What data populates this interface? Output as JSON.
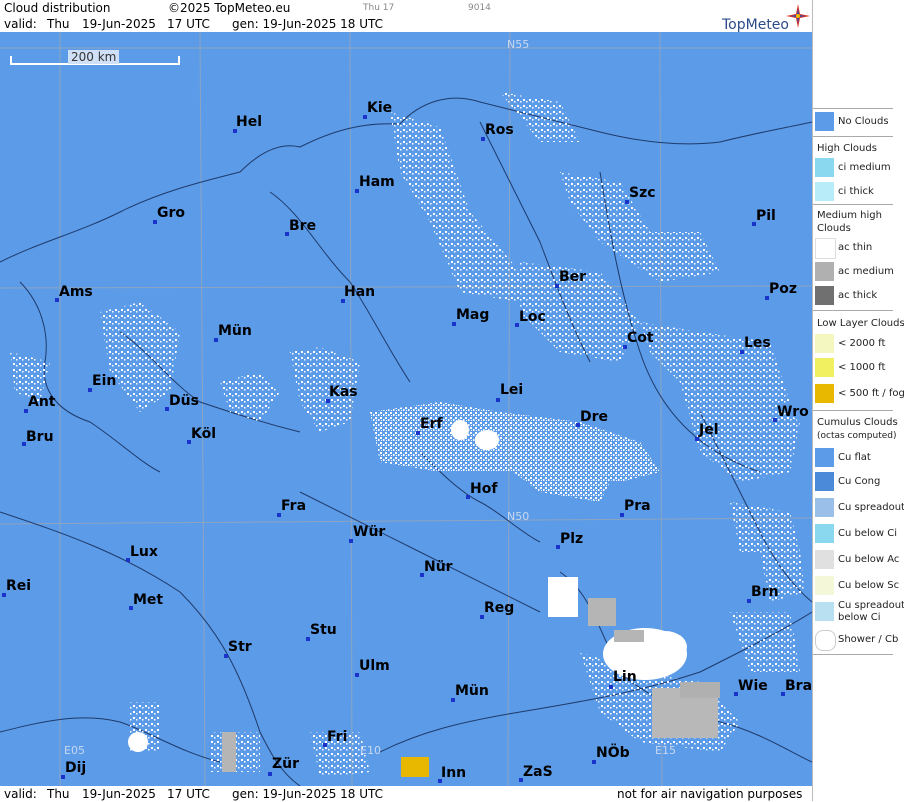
{
  "header": {
    "title": "Cloud distribution",
    "copyright": "©2025 TopMeteo.eu",
    "tiny1": "Thu 17",
    "tiny2": "9014",
    "valid_label": "valid:",
    "valid_day": "Thu",
    "valid_date": "19-Jun-2025",
    "valid_time": "17 UTC",
    "gen_label": "gen: 19-Jun-2025 18 UTC",
    "brand": "TopMeteo"
  },
  "footer": {
    "valid_label": "valid:",
    "valid_day": "Thu",
    "valid_date": "19-Jun-2025",
    "valid_time": "17 UTC",
    "gen_label": "gen: 19-Jun-2025 18 UTC",
    "disclaimer": "not for air navigation purposes"
  },
  "scale_label": "200 km",
  "grid_labels": {
    "n55": "N55",
    "n50": "N50",
    "e05": "E05",
    "e10": "E10",
    "e15": "E15"
  },
  "cities": [
    {
      "name": "Kie"
    },
    {
      "name": "Hel"
    },
    {
      "name": "Ros"
    },
    {
      "name": "Ham"
    },
    {
      "name": "Szc"
    },
    {
      "name": "Gro"
    },
    {
      "name": "Bre"
    },
    {
      "name": "Pil"
    },
    {
      "name": "Ber"
    },
    {
      "name": "Ams"
    },
    {
      "name": "Han"
    },
    {
      "name": "Poz"
    },
    {
      "name": "Mag"
    },
    {
      "name": "Loc"
    },
    {
      "name": "Mün"
    },
    {
      "name": "Cot"
    },
    {
      "name": "Les"
    },
    {
      "name": "Ein"
    },
    {
      "name": "Kas"
    },
    {
      "name": "Lei"
    },
    {
      "name": "Ant"
    },
    {
      "name": "Düs"
    },
    {
      "name": "Wro"
    },
    {
      "name": "Erf"
    },
    {
      "name": "Dre"
    },
    {
      "name": "Bru"
    },
    {
      "name": "Köl"
    },
    {
      "name": "Jel"
    },
    {
      "name": "Hof"
    },
    {
      "name": "Fra"
    },
    {
      "name": "Pra"
    },
    {
      "name": "Wür"
    },
    {
      "name": "Plz"
    },
    {
      "name": "Lux"
    },
    {
      "name": "Nür"
    },
    {
      "name": "Rei"
    },
    {
      "name": "Met"
    },
    {
      "name": "Reg"
    },
    {
      "name": "Brn"
    },
    {
      "name": "Stu"
    },
    {
      "name": "Str"
    },
    {
      "name": "Ulm"
    },
    {
      "name": "Lin"
    },
    {
      "name": "Mün"
    },
    {
      "name": "Wie"
    },
    {
      "name": "Bra"
    },
    {
      "name": "Fri"
    },
    {
      "name": "NÖb"
    },
    {
      "name": "Dij"
    },
    {
      "name": "Zür"
    },
    {
      "name": "Inn"
    },
    {
      "name": "ZaS"
    }
  ],
  "legend": {
    "no_clouds": "No Clouds",
    "high_title": "High Clouds",
    "ci_medium": "ci medium",
    "ci_thick": "ci thick",
    "medium_title_1": "Medium high",
    "medium_title_2": "Clouds",
    "ac_thin": "ac thin",
    "ac_medium": "ac medium",
    "ac_thick": "ac thick",
    "low_title": "Low Layer Clouds",
    "low_2000": "< 2000 ft",
    "low_1000": "< 1000 ft",
    "low_500": "< 500 ft / fog",
    "cu_title": "Cumulus Clouds",
    "cu_sub": "(octas computed)",
    "cu_flat": "Cu flat",
    "cu_cong": "Cu Cong",
    "cu_spreadout": "Cu spreadout",
    "cu_below_ci": "Cu below Ci",
    "cu_below_ac": "Cu below Ac",
    "cu_below_sc": "Cu below Sc",
    "cu_spread_ci_1": "Cu spreadout",
    "cu_spread_ci_2": "below Ci",
    "shower": "Shower / Cb"
  },
  "colors": {
    "sea_land": "#5b9be8",
    "city_dot": "#1a33c8",
    "fog": "#e8b800",
    "cloud": "#ffffff",
    "ac_medium": "#b0b0b0"
  }
}
